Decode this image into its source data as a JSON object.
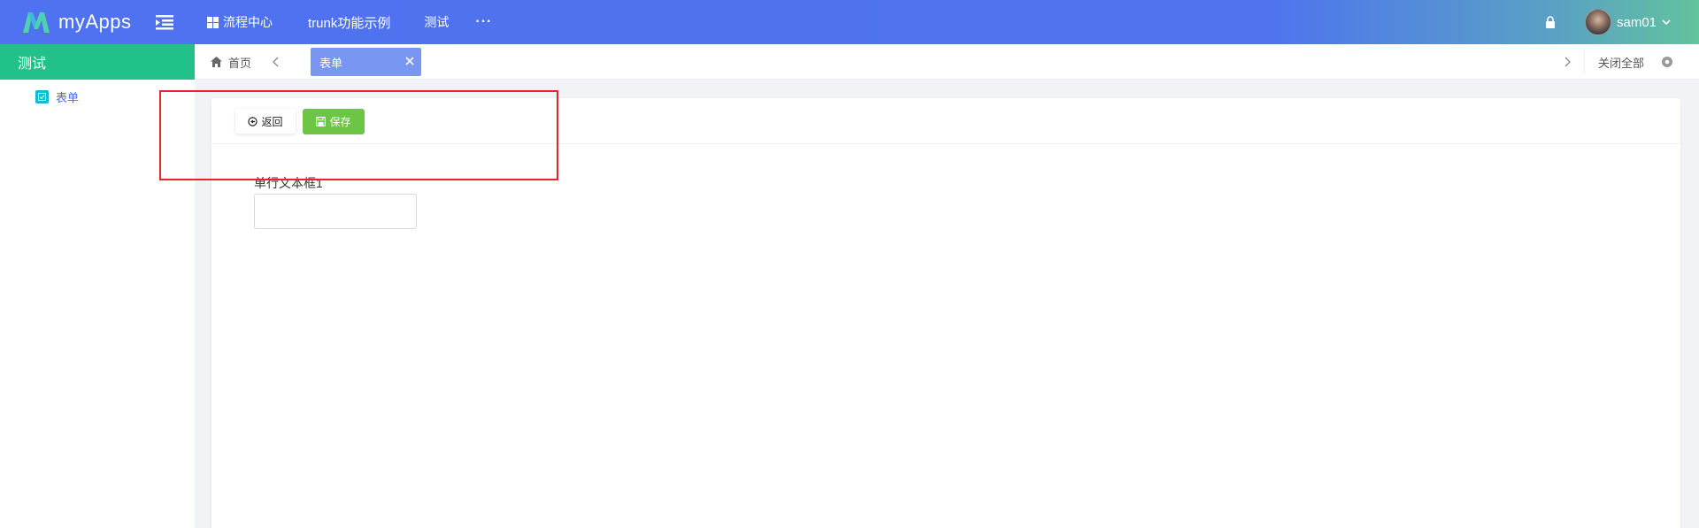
{
  "app": {
    "name": "myApps"
  },
  "topbar": {
    "nav": [
      {
        "label": "流程中心"
      },
      {
        "label": "trunk功能示例"
      },
      {
        "label": "测试"
      }
    ],
    "more_label": "···",
    "user": {
      "name": "sam01"
    }
  },
  "sidebar": {
    "header": "测试",
    "items": [
      {
        "label": "表单"
      }
    ]
  },
  "tabs": {
    "home_label": "首页",
    "active_label": "表单",
    "close_all_label": "关闭全部"
  },
  "toolbar": {
    "back_label": "返回",
    "save_label": "保存"
  },
  "form": {
    "field_label": "单行文本框1",
    "field_value": ""
  },
  "colors": {
    "topbar": "#4f72f0",
    "sidebar_header": "#22c18a",
    "active_tab": "#7896f2",
    "save_button": "#6cc544",
    "highlight": "#e8242a"
  },
  "icons": [
    "logo-icon",
    "menu-toggle-icon",
    "grid-icon",
    "more-icon",
    "lock-icon",
    "avatar",
    "chevron-down-icon",
    "form-icon",
    "home-icon",
    "chevron-left-icon",
    "close-icon",
    "chevron-right-icon",
    "gear-icon",
    "back-icon",
    "save-icon"
  ]
}
